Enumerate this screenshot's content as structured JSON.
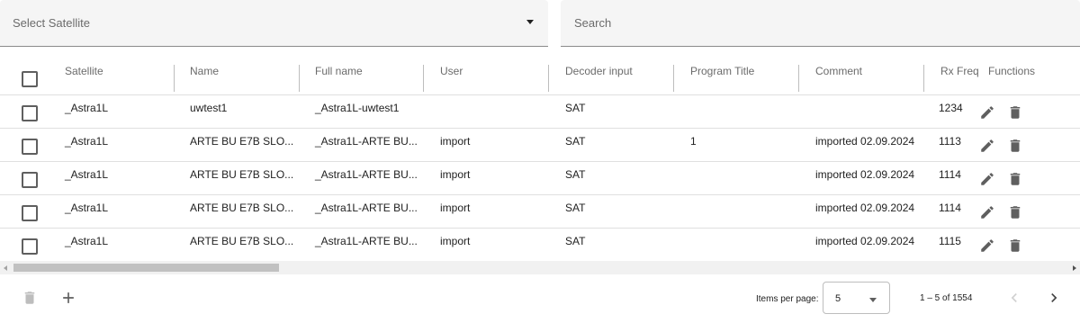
{
  "filters": {
    "satellite_placeholder": "Select Satellite",
    "search_placeholder": "Search"
  },
  "table": {
    "headers": {
      "satellite": "Satellite",
      "name": "Name",
      "full_name": "Full name",
      "user": "User",
      "decoder_input": "Decoder input",
      "program_title": "Program Title",
      "comment": "Comment",
      "rx_freq": "Rx Freq",
      "functions": "Functions"
    },
    "rows": [
      {
        "satellite": "_Astra1L",
        "name": "uwtest1",
        "full_name": "_Astra1L-uwtest1",
        "user": "",
        "decoder_input": "SAT",
        "program_title": "",
        "comment": "",
        "rx_freq": "1234"
      },
      {
        "satellite": "_Astra1L",
        "name": "ARTE BU E7B SLO...",
        "full_name": "_Astra1L-ARTE BU...",
        "user": "import",
        "decoder_input": "SAT",
        "program_title": "1",
        "comment": "imported 02.09.2024",
        "rx_freq": "1113"
      },
      {
        "satellite": "_Astra1L",
        "name": "ARTE BU E7B SLO...",
        "full_name": "_Astra1L-ARTE BU...",
        "user": "import",
        "decoder_input": "SAT",
        "program_title": "",
        "comment": "imported 02.09.2024",
        "rx_freq": "1114"
      },
      {
        "satellite": "_Astra1L",
        "name": "ARTE BU E7B SLO...",
        "full_name": "_Astra1L-ARTE BU...",
        "user": "import",
        "decoder_input": "SAT",
        "program_title": "",
        "comment": "imported 02.09.2024",
        "rx_freq": "1114"
      },
      {
        "satellite": "_Astra1L",
        "name": "ARTE BU E7B SLO...",
        "full_name": "_Astra1L-ARTE BU...",
        "user": "import",
        "decoder_input": "SAT",
        "program_title": "",
        "comment": "imported 02.09.2024",
        "rx_freq": "1115"
      }
    ]
  },
  "footer": {
    "items_per_page_label": "Items per page:",
    "items_per_page_value": "5",
    "range_label": "1 – 5 of 1554"
  },
  "icons": {
    "edit": "pencil-icon",
    "delete": "trash-icon",
    "add": "plus-icon",
    "prev": "chevron-left-icon",
    "next": "chevron-right-icon"
  },
  "colors": {
    "field_bg": "#f5f5f5",
    "icon": "#5f5f5f",
    "disabled": "#bdbdbd"
  }
}
